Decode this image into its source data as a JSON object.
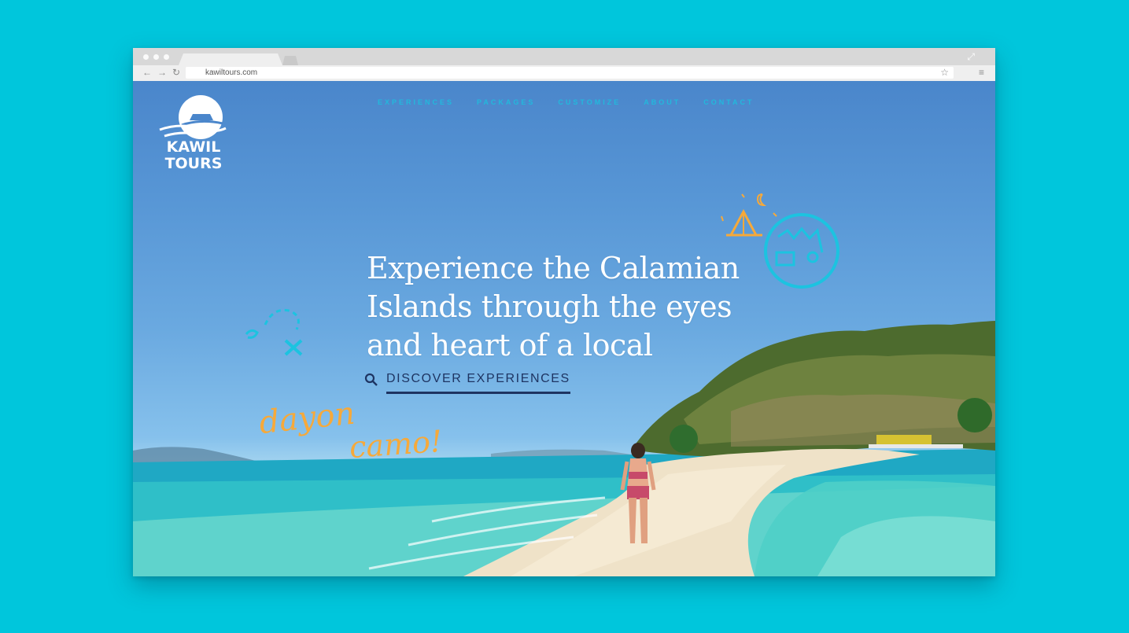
{
  "browser": {
    "url": "kawiltours.com"
  },
  "site": {
    "logo_line1": "KAWIL",
    "logo_line2": "TOURS",
    "nav": [
      "EXPERIENCES",
      "PACKAGES",
      "CUSTOMIZE",
      "ABOUT",
      "CONTACT"
    ],
    "headline_lines": [
      "Experience the Calamian",
      "Islands through the eyes",
      "and heart of a local"
    ],
    "cta_label": "DISCOVER EXPERIENCES",
    "script_line1": "dayon",
    "script_line2": "camo!"
  },
  "colors": {
    "page_bg": "#00c6dc",
    "nav_text": "#22b8dc",
    "cta_text": "#1e3462",
    "script": "#f6a93a",
    "doodle_cyan": "#1cc3e0"
  },
  "icons": [
    "search-icon",
    "back-icon",
    "forward-icon",
    "reload-icon",
    "star-icon",
    "menu-icon",
    "expand-icon"
  ]
}
